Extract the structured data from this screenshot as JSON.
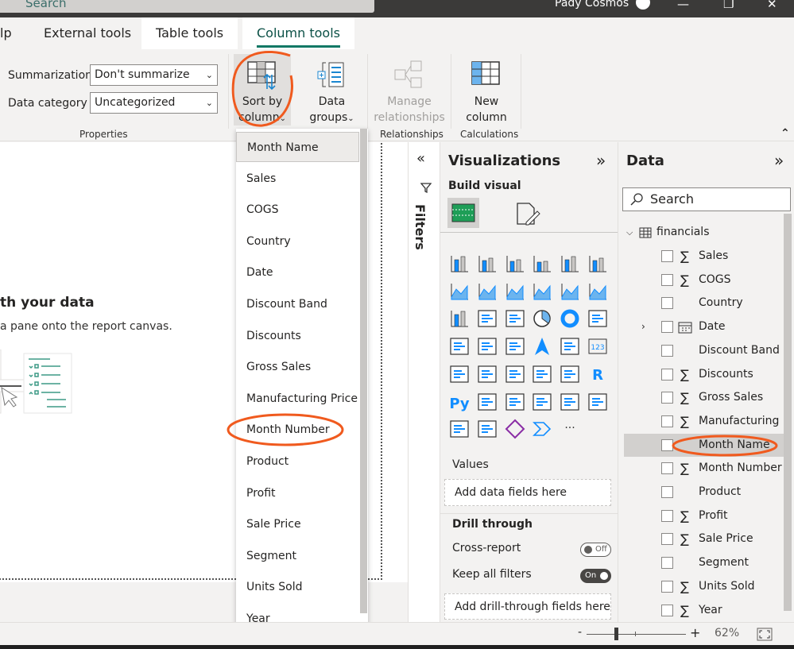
{
  "titlebar": {
    "search_placeholder": "Search",
    "user": "Pady Cosmos",
    "minimize": "—",
    "restore": "❐",
    "close": "✕"
  },
  "tabs": [
    {
      "label": "lp"
    },
    {
      "label": "External tools"
    },
    {
      "label": "Table tools"
    },
    {
      "label": "Column tools",
      "active": true
    }
  ],
  "ribbon": {
    "summarization_label": "Summarization",
    "summarization_value": "Don't summarize",
    "data_category_label": "Data category",
    "data_category_value": "Uncategorized",
    "properties_group": "Properties",
    "sort_by_column": [
      "Sort by",
      "column"
    ],
    "data_groups": [
      "Data",
      "groups"
    ],
    "manage_relationships": [
      "Manage",
      "relationships"
    ],
    "relationships_group": "Relationships",
    "new_column": [
      "New",
      "column"
    ],
    "calculations_group": "Calculations",
    "collapse": "⌃"
  },
  "canvas": {
    "heading": "th your data",
    "subtext": "a pane onto the report canvas."
  },
  "sort_dropdown": {
    "items": [
      "Month Name",
      "Sales",
      "COGS",
      "Country",
      "Date",
      "Discount Band",
      "Discounts",
      "Gross Sales",
      "Manufacturing Price",
      "Month Number",
      "Product",
      "Profit",
      "Sale Price",
      "Segment",
      "Units Sold",
      "Year"
    ],
    "selected": "Month Name"
  },
  "filters": {
    "label": "Filters",
    "collapse": "«"
  },
  "visualizations": {
    "title": "Visualizations",
    "expand": "»",
    "build_visual": "Build visual",
    "icons": [
      "stacked-bar",
      "stacked-column",
      "clustered-bar",
      "clustered-column",
      "100-stacked-bar",
      "100-stacked-column",
      "line",
      "area",
      "stacked-area",
      "line-column",
      "line-clustered-column",
      "ribbon",
      "waterfall",
      "funnel",
      "scatter",
      "pie",
      "donut",
      "treemap",
      "map",
      "filled-map",
      "shape-map",
      "azure-map",
      "gauge",
      "card",
      "multi-row-card",
      "kpi",
      "slicer",
      "table",
      "matrix",
      "r-visual",
      "python-visual",
      "key-influencers",
      "decomposition-tree",
      "qa",
      "paginated-report",
      "metrics",
      "power-bi-report",
      "arcgis",
      "power-apps",
      "power-automate",
      "more"
    ],
    "values_label": "Values",
    "values_placeholder": "Add data fields here",
    "drill_through": "Drill through",
    "cross_report": "Cross-report",
    "cross_report_state": "Off",
    "keep_filters": "Keep all filters",
    "keep_filters_state": "On",
    "drill_placeholder": "Add drill-through fields here"
  },
  "data_pane": {
    "title": "Data",
    "expand": "»",
    "search_placeholder": "Search",
    "table": "financials",
    "fields": [
      {
        "name": "Sales",
        "sigma": true
      },
      {
        "name": "COGS",
        "sigma": true
      },
      {
        "name": "Country",
        "sigma": false
      },
      {
        "name": "Date",
        "sigma": false,
        "date": true
      },
      {
        "name": "Discount Band",
        "sigma": false
      },
      {
        "name": "Discounts",
        "sigma": true
      },
      {
        "name": "Gross Sales",
        "sigma": true
      },
      {
        "name": "Manufacturing ...",
        "sigma": true
      },
      {
        "name": "Month Name",
        "sigma": false,
        "selected": true
      },
      {
        "name": "Month Number",
        "sigma": true
      },
      {
        "name": "Product",
        "sigma": false
      },
      {
        "name": "Profit",
        "sigma": true
      },
      {
        "name": "Sale Price",
        "sigma": true
      },
      {
        "name": "Segment",
        "sigma": false
      },
      {
        "name": "Units Sold",
        "sigma": true
      },
      {
        "name": "Year",
        "sigma": true
      }
    ]
  },
  "status": {
    "zoom": "62%",
    "minus": "-",
    "plus": "+",
    "zoom_percent": 62
  },
  "colors": {
    "accent": "#117865",
    "annotation": "#f05a1e",
    "viz_blue": "#118dff"
  }
}
